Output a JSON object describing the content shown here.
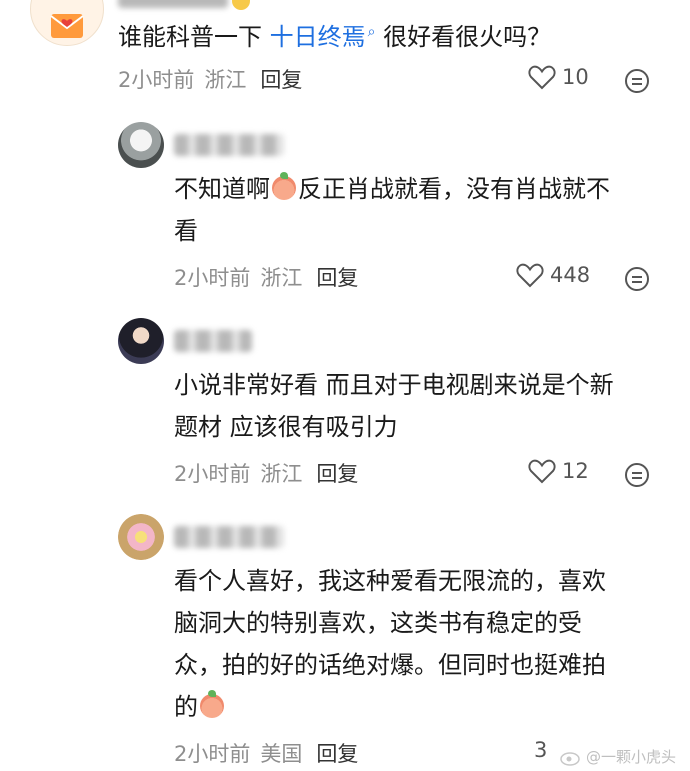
{
  "top_comment": {
    "text_prefix": "谁能科普一下 ",
    "topic_link": "十日终焉",
    "text_suffix": "  很好看很火吗？",
    "time": "2小时前",
    "location": "浙江",
    "reply_label": "回复",
    "likes": "10"
  },
  "replies": [
    {
      "text_a": "不知道啊",
      "text_b": "反正肖战就看，没有肖战就不",
      "text_c": "看",
      "time": "2小时前",
      "location": "浙江",
      "reply_label": "回复",
      "likes": "448"
    },
    {
      "text_a": "小说非常好看 而且对于电视剧来说是个新",
      "text_b": "题材 应该很有吸引力",
      "time": "2小时前",
      "location": "浙江",
      "reply_label": "回复",
      "likes": "12"
    },
    {
      "text_a": "看个人喜好，我这种爱看无限流的，喜欢",
      "text_b": "脑洞大的特别喜欢，这类书有稳定的受",
      "text_c": "众，拍的好的话绝对爆。但同时也挺难拍",
      "text_d": "的",
      "time": "2小时前",
      "location": "美国",
      "reply_label": "回复",
      "likes": "3"
    }
  ],
  "watermark": "@一颗小虎头",
  "colors": {
    "topic_link": "#1e6fe0",
    "meta": "#8e8e8e"
  },
  "icons": [
    "heart-outline-icon",
    "more-dots-icon",
    "emoji-peach-icon"
  ]
}
